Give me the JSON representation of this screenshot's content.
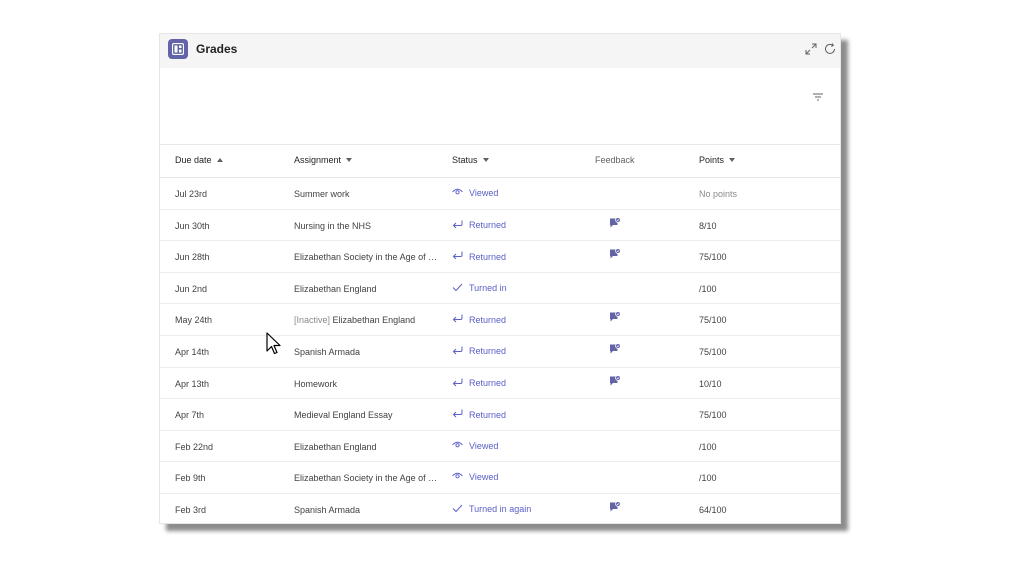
{
  "app": {
    "title": "Grades",
    "icon": "grades-app-icon"
  },
  "titlebar": {
    "expand_icon": "expand-icon",
    "refresh_icon": "refresh-icon"
  },
  "toolbar": {
    "filter_icon": "filter-icon"
  },
  "table": {
    "headers": {
      "due_date": "Due date",
      "assignment": "Assignment",
      "status": "Status",
      "feedback": "Feedback",
      "points": "Points"
    },
    "rows": [
      {
        "due": "Jul 23rd",
        "assignment": "Summer work",
        "prefix": "",
        "status": "Viewed",
        "status_icon": "eye-icon",
        "feedback": false,
        "points": "No points"
      },
      {
        "due": "Jun 30th",
        "assignment": "Nursing in the NHS",
        "prefix": "",
        "status": "Returned",
        "status_icon": "return-icon",
        "feedback": true,
        "points": "8/10"
      },
      {
        "due": "Jun 28th",
        "assignment": "Elizabethan Society in the Age of Ex...",
        "prefix": "",
        "status": "Returned",
        "status_icon": "return-icon",
        "feedback": true,
        "points": "75/100"
      },
      {
        "due": "Jun 2nd",
        "assignment": "Elizabethan England",
        "prefix": "",
        "status": "Turned in",
        "status_icon": "check-icon",
        "feedback": false,
        "points": "/100"
      },
      {
        "due": "May 24th",
        "assignment": "Elizabethan England",
        "prefix": "[Inactive]",
        "status": "Returned",
        "status_icon": "return-icon",
        "feedback": true,
        "points": "75/100"
      },
      {
        "due": "Apr 14th",
        "assignment": "Spanish Armada",
        "prefix": "",
        "status": "Returned",
        "status_icon": "return-icon",
        "feedback": true,
        "points": "75/100"
      },
      {
        "due": "Apr 13th",
        "assignment": "Homework",
        "prefix": "",
        "status": "Returned",
        "status_icon": "return-icon",
        "feedback": true,
        "points": "10/10"
      },
      {
        "due": "Apr 7th",
        "assignment": "Medieval England Essay",
        "prefix": "",
        "status": "Returned",
        "status_icon": "return-icon",
        "feedback": false,
        "points": "75/100"
      },
      {
        "due": "Feb 22nd",
        "assignment": "Elizabethan England",
        "prefix": "",
        "status": "Viewed",
        "status_icon": "eye-icon",
        "feedback": false,
        "points": "/100"
      },
      {
        "due": "Feb 9th",
        "assignment": "Elizabethan Society in the Age of Ex...",
        "prefix": "",
        "status": "Viewed",
        "status_icon": "eye-icon",
        "feedback": false,
        "points": "/100"
      },
      {
        "due": "Feb 3rd",
        "assignment": "Spanish Armada",
        "prefix": "",
        "status": "Turned in again",
        "status_icon": "check-icon",
        "feedback": true,
        "points": "64/100"
      }
    ]
  },
  "colors": {
    "accent": "#5b5fc7",
    "brand": "#6264a7"
  }
}
